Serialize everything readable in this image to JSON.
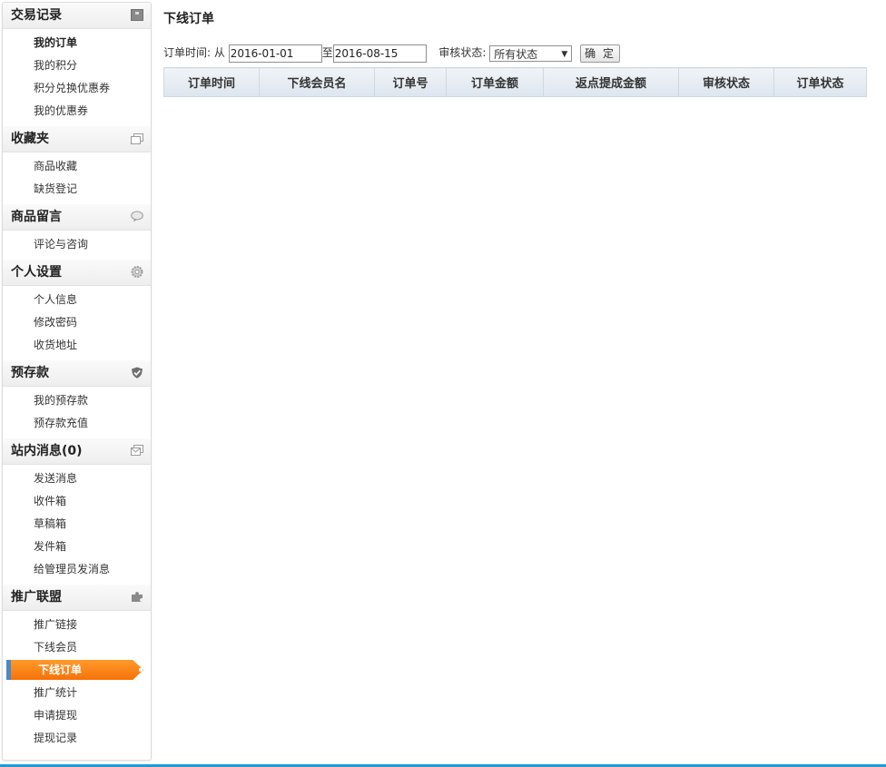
{
  "sidebar": {
    "groups": [
      {
        "title": "交易记录",
        "icon": "box-icon",
        "items": [
          "我的订单",
          "我的积分",
          "积分兑换优惠券",
          "我的优惠券"
        ]
      },
      {
        "title": "收藏夹",
        "icon": "folders-icon",
        "items": [
          "商品收藏",
          "缺货登记"
        ]
      },
      {
        "title": "商品留言",
        "icon": "speech-bubble-icon",
        "items": [
          "评论与咨询"
        ]
      },
      {
        "title": "个人设置",
        "icon": "gear-icon",
        "items": [
          "个人信息",
          "修改密码",
          "收货地址"
        ]
      },
      {
        "title": "预存款",
        "icon": "shield-check-icon",
        "items": [
          "我的预存款",
          "预存款充值"
        ]
      },
      {
        "title": "站内消息(0)",
        "icon": "envelope-icon",
        "items": [
          "发送消息",
          "收件箱",
          "草稿箱",
          "发件箱",
          "给管理员发消息"
        ]
      },
      {
        "title": "推广联盟",
        "icon": "puzzle-icon",
        "items": [
          "推广链接",
          "下线会员",
          "下线订单",
          "推广统计",
          "申请提现",
          "提现记录"
        ]
      }
    ],
    "active_item": "下线订单"
  },
  "main": {
    "title": "下线订单",
    "filter": {
      "order_time_label": "订单时间: 从",
      "date_from": "2016-01-01",
      "to_label": "至",
      "date_to": "2016-08-15",
      "status_label": "审核状态:",
      "status_selected": "所有状态",
      "submit_label": "确 定"
    },
    "table": {
      "columns": [
        "订单时间",
        "下线会员名",
        "订单号",
        "订单金额",
        "返点提成金额",
        "审核状态",
        "订单状态"
      ]
    }
  },
  "colors": {
    "active_flag": "#f5720a",
    "active_bar": "#4a88c8",
    "bottom_line": "#1e9ad6",
    "table_header": "#dde5ee"
  }
}
